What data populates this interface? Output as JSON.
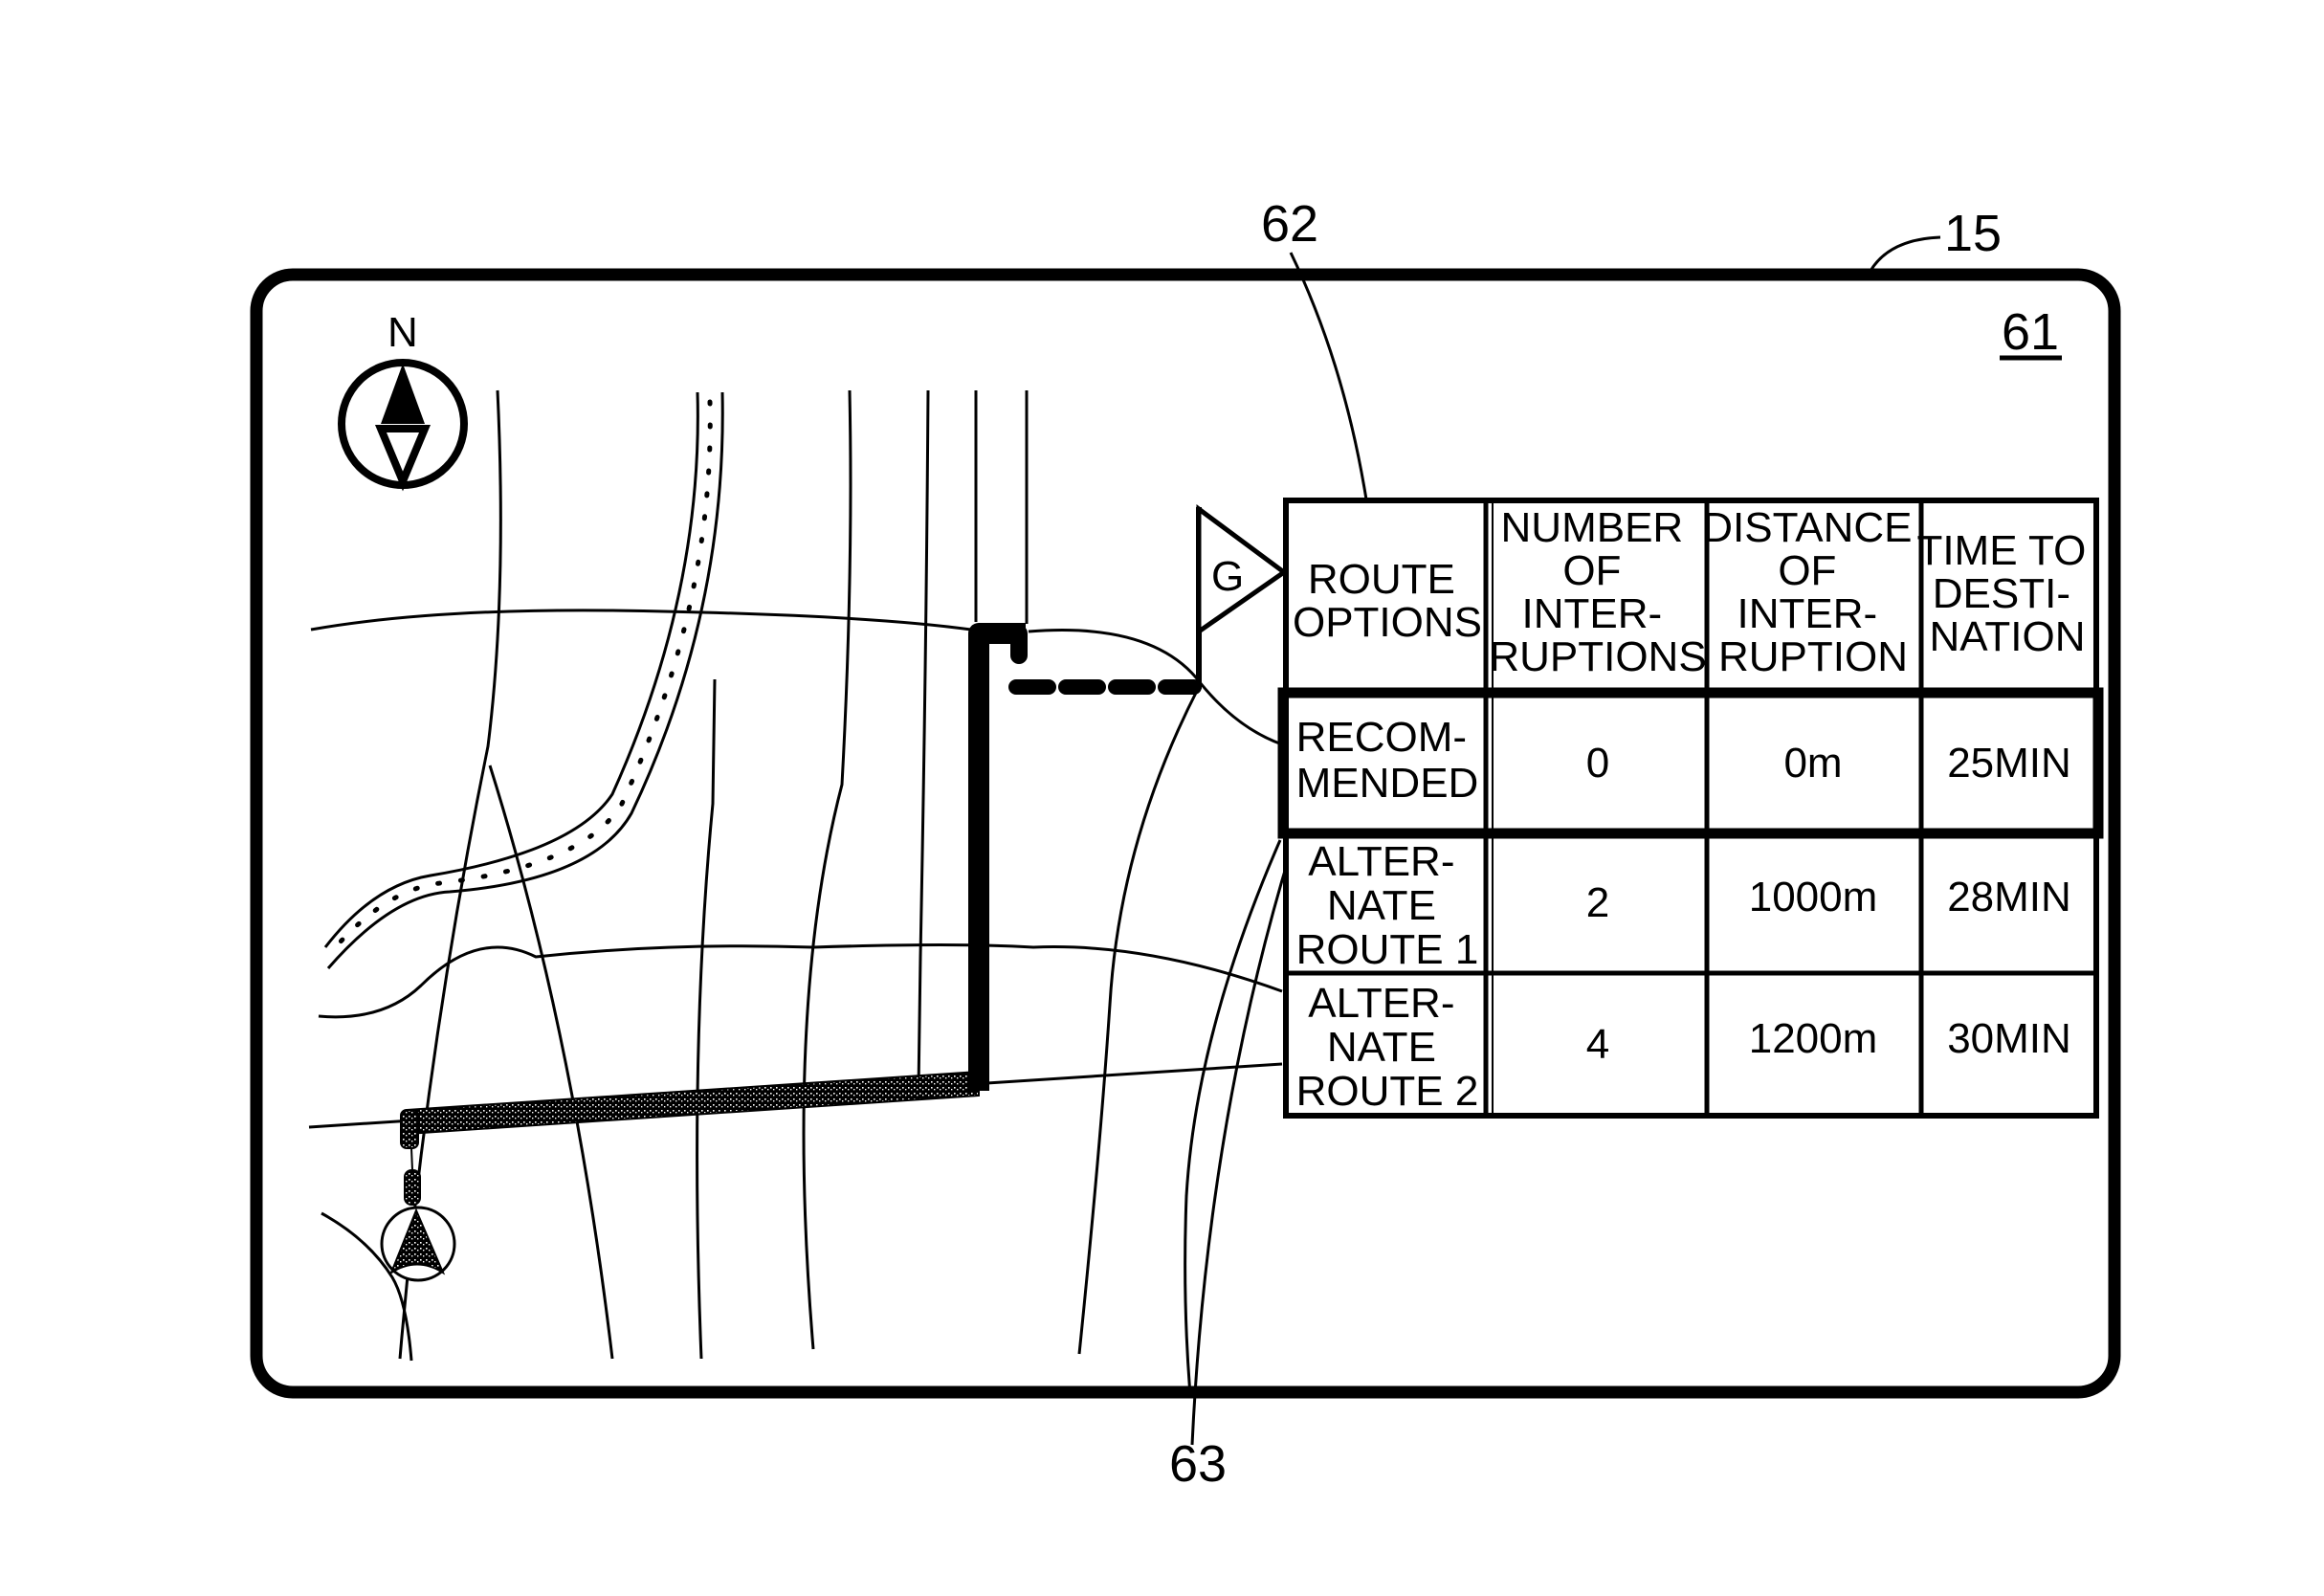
{
  "figure": {
    "type": "patent-drawing",
    "reference_labels": {
      "device": "15",
      "screen": "61",
      "route_table": "62",
      "route_line": "63"
    },
    "compass": {
      "label": "N",
      "icon": "north-compass-icon"
    },
    "goal_flag": {
      "label": "G",
      "icon": "goal-flag-icon"
    },
    "vehicle_marker": {
      "icon": "vehicle-position-arrow-icon"
    },
    "colors": {
      "ink": "#000000",
      "paper": "#ffffff"
    }
  },
  "route_table": {
    "headers": [
      [
        "ROUTE",
        "OPTIONS"
      ],
      [
        "NUMBER",
        "OF",
        "INTER-",
        "RUPTIONS"
      ],
      [
        "DISTANCE",
        "OF",
        "INTER-",
        "RUPTION"
      ],
      [
        "TIME TO",
        "DESTI-",
        "NATION"
      ]
    ],
    "rows": [
      {
        "option": [
          "RECOM-",
          "MENDED"
        ],
        "interruptions": "0",
        "distance": "0m",
        "time": "25MIN",
        "selected": true
      },
      {
        "option": [
          "ALTER-",
          "NATE",
          "ROUTE 1"
        ],
        "interruptions": "2",
        "distance": "1000m",
        "time": "28MIN",
        "selected": false
      },
      {
        "option": [
          "ALTER-",
          "NATE",
          "ROUTE 2"
        ],
        "interruptions": "4",
        "distance": "1200m",
        "time": "30MIN",
        "selected": false
      }
    ]
  }
}
